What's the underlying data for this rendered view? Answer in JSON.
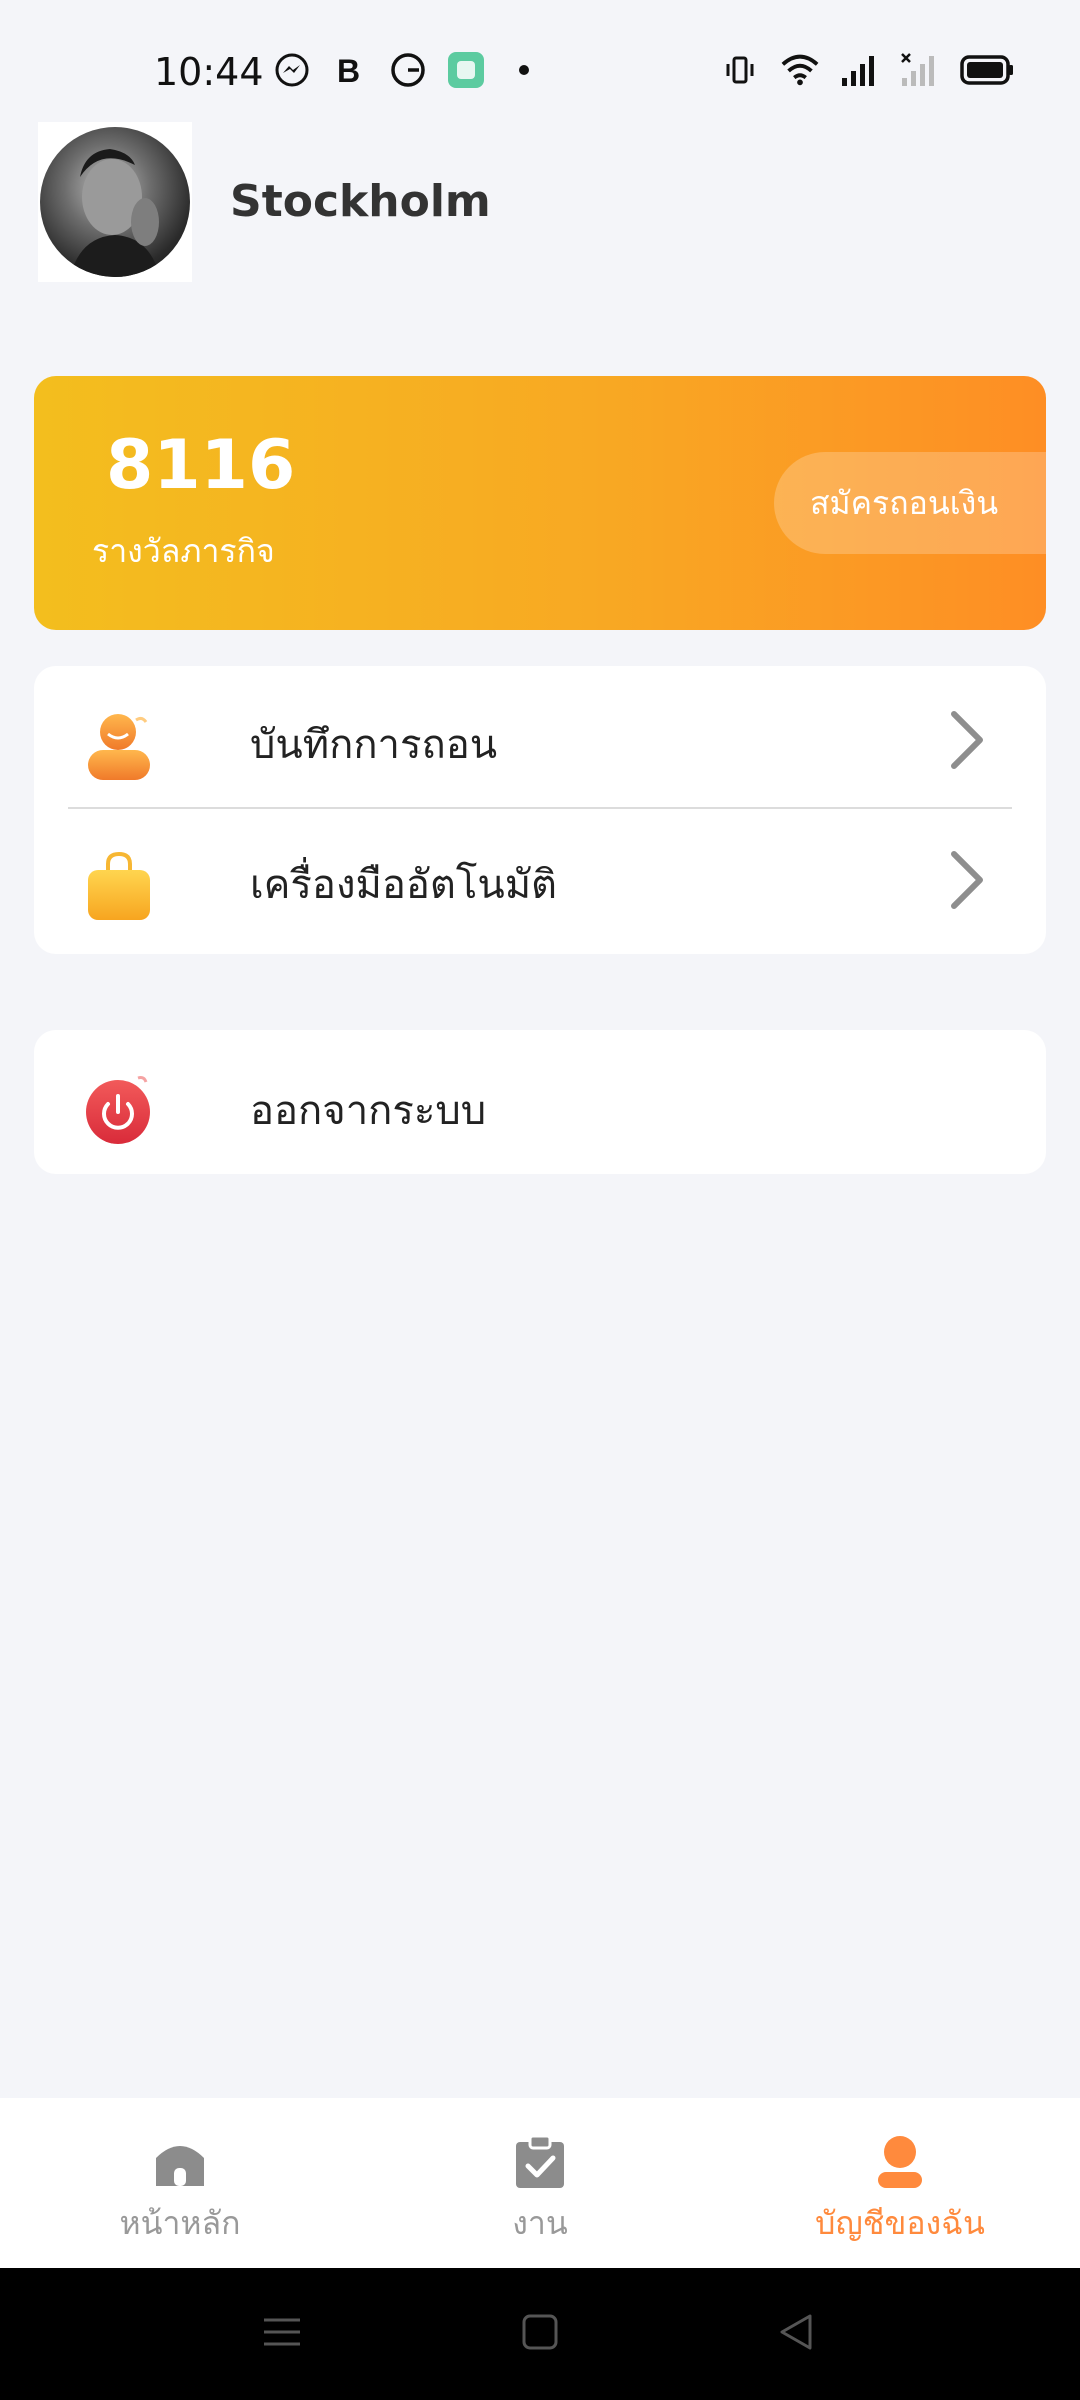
{
  "status_bar": {
    "time": "10:44",
    "left_icons": [
      "messenger-icon",
      "bold-b-icon",
      "grammarly-icon",
      "green-app-icon",
      "notification-dot"
    ],
    "right_icons": [
      "vibrate-icon",
      "wifi-icon",
      "signal-icon",
      "signal-nodata-icon",
      "battery-icon"
    ]
  },
  "profile": {
    "name": "Stockholm"
  },
  "reward_card": {
    "value": "8116",
    "label": "รางวัลภารกิจ",
    "withdraw_button": "สมัครถอนเงิน",
    "gradient_colors": [
      "#f3be1e",
      "#fe8e24"
    ]
  },
  "menu": {
    "items": [
      {
        "label": "บันทึกการถอน",
        "icon": "user-record-icon"
      },
      {
        "label": "เครื่องมืออัตโนมัติ",
        "icon": "shopping-bag-icon"
      }
    ]
  },
  "logout": {
    "label": "ออกจากระบบ",
    "icon": "power-icon"
  },
  "bottom_nav": {
    "items": [
      {
        "label": "หน้าหลัก",
        "icon": "home-icon",
        "active": false
      },
      {
        "label": "งาน",
        "icon": "clipboard-check-icon",
        "active": false
      },
      {
        "label": "บัญชีของฉัน",
        "icon": "person-icon",
        "active": true
      }
    ],
    "active_color": "#ff8a3d",
    "inactive_color": "#999999"
  },
  "system_nav": {
    "buttons": [
      "menu-icon",
      "home-square-icon",
      "back-triangle-icon"
    ]
  }
}
